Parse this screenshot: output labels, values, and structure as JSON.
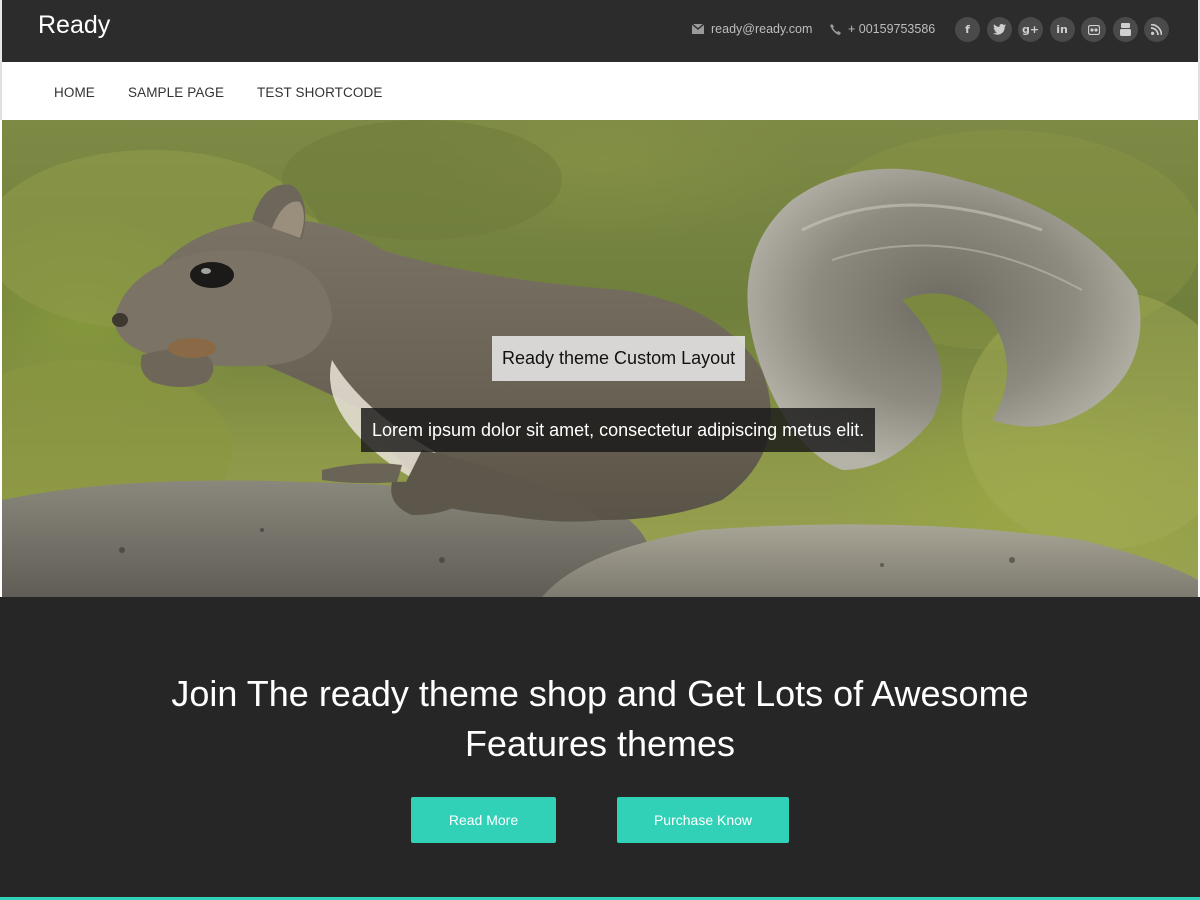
{
  "header": {
    "site_title": "Ready",
    "email": "ready@ready.com",
    "phone": "+ 00159753586",
    "socials": [
      {
        "name": "facebook",
        "glyph": "f"
      },
      {
        "name": "twitter",
        "glyph": "t"
      },
      {
        "name": "google-plus",
        "glyph": "g+"
      },
      {
        "name": "linkedin",
        "glyph": "in"
      },
      {
        "name": "flickr",
        "glyph": "••"
      },
      {
        "name": "youtube",
        "glyph": "▶"
      },
      {
        "name": "rss",
        "glyph": "rss"
      }
    ]
  },
  "nav": {
    "items": [
      {
        "label": "HOME"
      },
      {
        "label": "SAMPLE PAGE"
      },
      {
        "label": "TEST SHORTCODE"
      }
    ]
  },
  "hero": {
    "image": "squirrel-on-rock",
    "caption_title": "Ready theme Custom Layout",
    "caption_text": "Lorem ipsum dolor sit amet, consectetur adipiscing metus elit."
  },
  "cta": {
    "heading_line1": "Join The ready theme shop and Get Lots of Awesome",
    "heading_line2": "Features themes",
    "read_more_label": "Read More",
    "purchase_label": "Purchase Know"
  },
  "colors": {
    "topbar": "#2c2c2c",
    "cta_background": "#262626",
    "accent": "#31d1b8"
  }
}
